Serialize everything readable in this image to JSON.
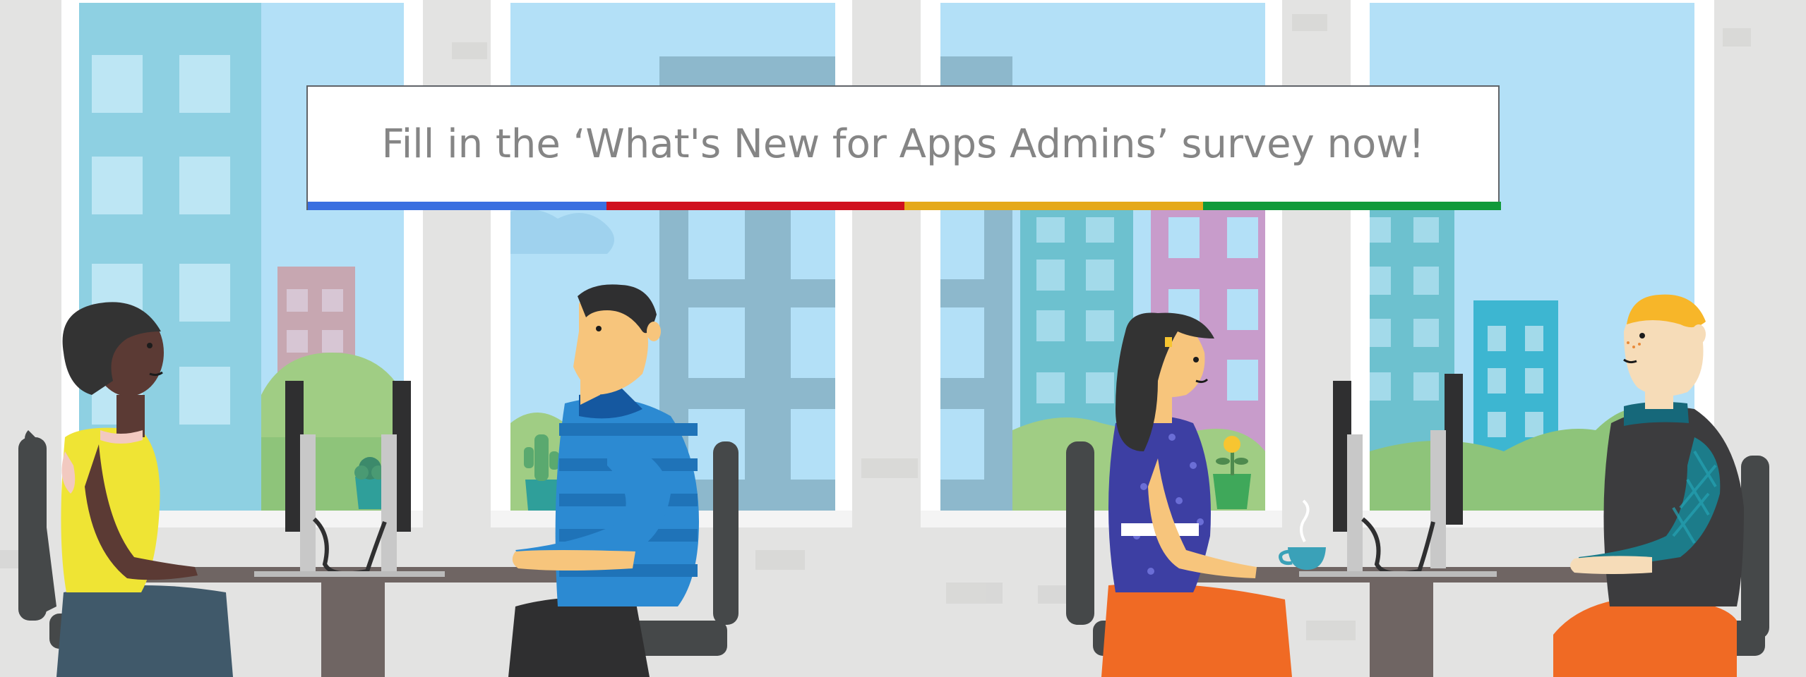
{
  "banner": {
    "text": "Fill in the ‘What's New for Apps Admins’ survey now!",
    "stripe_colors": [
      "#3a6fe0",
      "#d0101e",
      "#e5a91a",
      "#109a3a"
    ]
  },
  "colors": {
    "wall": "#e3e3e2",
    "sky": "#b3e0f7",
    "window_frame": "#ffffff",
    "desk": "#6f6563",
    "chair": "#454849"
  },
  "scene": {
    "people": [
      {
        "name": "woman-yellow-shirt"
      },
      {
        "name": "man-blue-striped-shirt"
      },
      {
        "name": "woman-purple-dress"
      },
      {
        "name": "man-teal-sleeves"
      }
    ]
  }
}
